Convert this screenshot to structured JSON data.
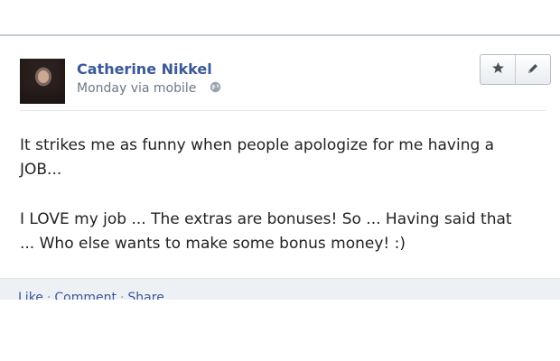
{
  "post": {
    "author": "Catherine Nikkel",
    "meta": "Monday via mobile",
    "text_line1": "It strikes me as funny when people apologize for me having a",
    "text_line2": "JOB...",
    "text_line3": "I LOVE my job ... The extras are bonuses! So ... Having said that",
    "text_line4": "... Who else wants to make some bonus money! :)"
  },
  "actions": {
    "favorite_icon": "star-icon",
    "edit_icon": "pencil-icon"
  },
  "footer": {
    "like": "Like",
    "comment": "Comment",
    "share": "Share",
    "separator": "·"
  },
  "colors": {
    "name": "#3b5998",
    "meta": "#6e7788",
    "footer_bg": "#edf0f5"
  }
}
